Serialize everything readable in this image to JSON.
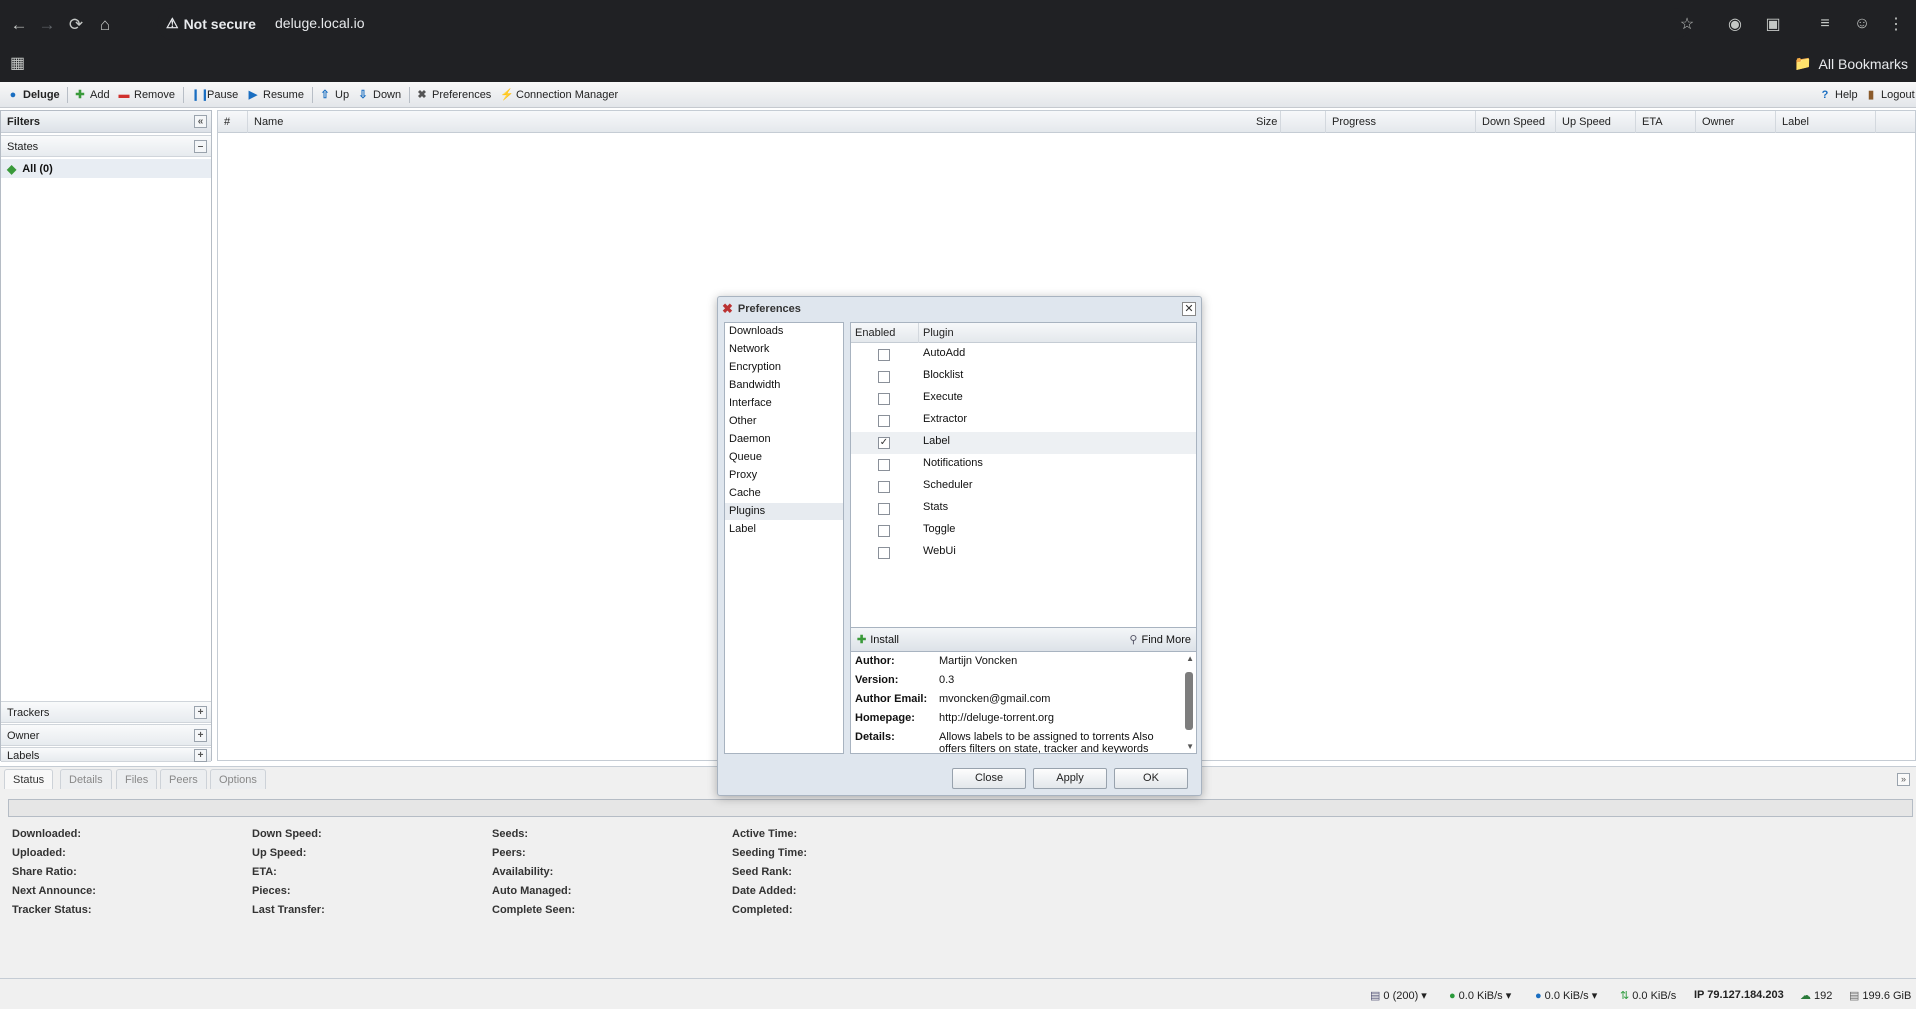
{
  "browser": {
    "security_label": "Not secure",
    "url": "deluge.local.io",
    "all_bookmarks": "All Bookmarks"
  },
  "toolbar": {
    "app_name": "Deluge",
    "add": "Add",
    "remove": "Remove",
    "pause": "Pause",
    "resume": "Resume",
    "up": "Up",
    "down": "Down",
    "preferences": "Preferences",
    "connection_manager": "Connection Manager",
    "help": "Help",
    "logout": "Logout"
  },
  "filters": {
    "title": "Filters",
    "states_label": "States",
    "all_item": "All (0)",
    "trackers": "Trackers",
    "owner": "Owner",
    "labels": "Labels"
  },
  "grid": {
    "columns": [
      "#",
      "Name",
      "Size",
      "Progress",
      "Down Speed",
      "Up Speed",
      "ETA",
      "Owner",
      "Label"
    ]
  },
  "details": {
    "tabs": [
      "Status",
      "Details",
      "Files",
      "Peers",
      "Options"
    ],
    "col1": [
      "Downloaded:",
      "Uploaded:",
      "Share Ratio:",
      "Next Announce:",
      "Tracker Status:"
    ],
    "col2": [
      "Down Speed:",
      "Up Speed:",
      "ETA:",
      "Pieces:",
      "Last Transfer:"
    ],
    "col3": [
      "Seeds:",
      "Peers:",
      "Availability:",
      "Auto Managed:",
      "Complete Seen:"
    ],
    "col4": [
      "Active Time:",
      "Seeding Time:",
      "Seed Rank:",
      "Date Added:",
      "Completed:"
    ]
  },
  "statusbar": {
    "connections": "0 (200)",
    "down_speed": "0.0 KiB/s",
    "up_speed": "0.0 KiB/s",
    "protocol": "0.0 KiB/s",
    "ip": "IP 79.127.184.203",
    "dht": "192",
    "free_space": "199.6 GiB"
  },
  "preferences": {
    "title": "Preferences",
    "nav": [
      "Downloads",
      "Network",
      "Encryption",
      "Bandwidth",
      "Interface",
      "Other",
      "Daemon",
      "Queue",
      "Proxy",
      "Cache",
      "Plugins",
      "Label"
    ],
    "selected_nav": "Plugins",
    "plugin_columns": [
      "Enabled",
      "Plugin"
    ],
    "plugins": [
      {
        "name": "AutoAdd",
        "enabled": false
      },
      {
        "name": "Blocklist",
        "enabled": false
      },
      {
        "name": "Execute",
        "enabled": false
      },
      {
        "name": "Extractor",
        "enabled": false
      },
      {
        "name": "Label",
        "enabled": true
      },
      {
        "name": "Notifications",
        "enabled": false
      },
      {
        "name": "Scheduler",
        "enabled": false
      },
      {
        "name": "Stats",
        "enabled": false
      },
      {
        "name": "Toggle",
        "enabled": false
      },
      {
        "name": "WebUi",
        "enabled": false
      }
    ],
    "install": "Install",
    "find_more": "Find More",
    "info": {
      "author_label": "Author:",
      "author": "Martijn Voncken",
      "version_label": "Version:",
      "version": "0.3",
      "email_label": "Author Email:",
      "email": "mvoncken@gmail.com",
      "homepage_label": "Homepage:",
      "homepage": "http://deluge-torrent.org",
      "details_label": "Details:",
      "details": "Allows labels to be assigned to torrents Also offers filters on state, tracker and keywords"
    },
    "buttons": {
      "close": "Close",
      "apply": "Apply",
      "ok": "OK"
    }
  },
  "icons": {
    "back": "arrow-left-icon",
    "forward": "arrow-right-icon",
    "reload": "reload-icon",
    "home": "home-icon",
    "warning": "warning-icon",
    "star": "star-icon",
    "extensions": "puzzle-icon",
    "profile": "profile-icon",
    "menu": "kebab-menu-icon"
  },
  "colors": {
    "chrome_bg": "#202124",
    "deluge_blue": "#1a6ec1",
    "add_green": "#3a9a3a",
    "remove_red": "#d0312d"
  }
}
